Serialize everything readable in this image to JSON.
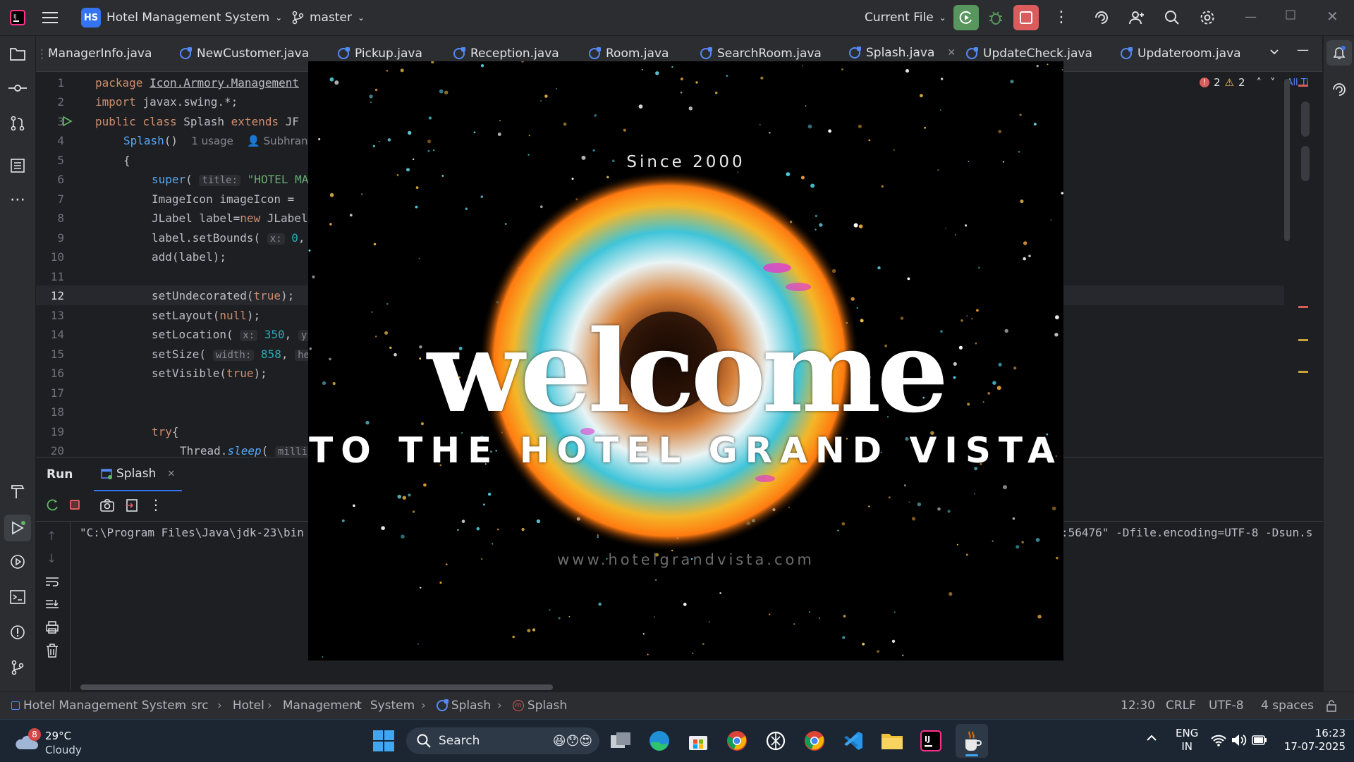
{
  "titlebar": {
    "project_badge": "HS",
    "project_name": "Hotel Management System",
    "branch": "master",
    "run_config": "Current File"
  },
  "tabs": [
    {
      "label": "ManagerInfo.java"
    },
    {
      "label": "NewCustomer.java"
    },
    {
      "label": "Pickup.java"
    },
    {
      "label": "Reception.java"
    },
    {
      "label": "Room.java"
    },
    {
      "label": "SearchRoom.java"
    },
    {
      "label": "Splash.java",
      "active": true
    },
    {
      "label": "UpdateCheck.java"
    },
    {
      "label": "Updateroom.java"
    }
  ],
  "inspections": {
    "errors": "2",
    "warnings": "2",
    "reader_hint": "All Ti"
  },
  "editor": {
    "line_numbers": [
      "1",
      "2",
      "3",
      "4",
      "5",
      "6",
      "7",
      "8",
      "9",
      "10",
      "11",
      "12",
      "13",
      "14",
      "15",
      "16",
      "17",
      "18",
      "19",
      "20"
    ],
    "current_line": "12",
    "lines": [
      {
        "kw": "package ",
        "rest": "Icon.Armory.Management"
      },
      {
        "kw": "import ",
        "rest": "javax.swing.*;"
      },
      {
        "kw": "public class ",
        "rest": "Splash ",
        "kw2": "extends ",
        "rest2": "JF"
      },
      {
        "fn": "Splash",
        "rest": "()",
        "usage": "1 usage",
        "author": "Subhrant"
      },
      {
        "rest": "{"
      },
      {
        "fn": "super",
        "rest": "(",
        "hint": "title:",
        "str": "\"HOTEL MANA"
      },
      {
        "rest": "ImageIcon imageIcon = "
      },
      {
        "rest": "JLabel label=",
        "kw": "new ",
        "rest2": "JLabel"
      },
      {
        "rest": "label.setBounds(",
        "hint": "x:",
        "num": "0",
        "rest2": ", y"
      },
      {
        "rest": "add(label);"
      },
      {
        "rest": ""
      },
      {
        "rest": "setUndecorated(",
        "kw": "true",
        "rest2": ");"
      },
      {
        "rest": "setLayout(",
        "kw": "null",
        "rest2": ");"
      },
      {
        "rest": "setLocation(",
        "hint": "x:",
        "num": "350",
        "rest2": ", ",
        "hint2": "y:"
      },
      {
        "rest": "setSize(",
        "hint": "width:",
        "num": "858",
        "rest2": ", ",
        "hint2": "heig"
      },
      {
        "rest": "setVisible(",
        "kw": "true",
        "rest2": ");"
      },
      {
        "rest": ""
      },
      {
        "rest": ""
      },
      {
        "kw": "try",
        "rest": "{"
      },
      {
        "rest": "Thread.",
        "italic": "sleep",
        "rest2": "(",
        "hint": "millis:"
      }
    ]
  },
  "run": {
    "title": "Run",
    "tab_label": "Splash",
    "console_left": "\"C:\\Program Files\\Java\\jdk-23\\bin",
    "console_right": ":56476\" -Dfile.encoding=UTF-8 -Dsun.s"
  },
  "splash": {
    "since": "Since 2000",
    "welcome": "welcome",
    "subtitle": "TO THE HOTEL GRAND VISTA",
    "website": "www.hotelgrandvista.com"
  },
  "statusbar": {
    "crumbs": [
      "Hotel Management System",
      "src",
      "Hotel",
      "Management",
      "System",
      "Splash",
      "Splash"
    ],
    "position": "12:30",
    "line_sep": "CRLF",
    "encoding": "UTF-8",
    "indent": "4 spaces"
  },
  "taskbar": {
    "weather_temp": "29°C",
    "weather_desc": "Cloudy",
    "weather_badge": "8",
    "search_placeholder": "Search",
    "lang_1": "ENG",
    "lang_2": "IN",
    "time": "16:23",
    "date": "17-07-2025"
  }
}
